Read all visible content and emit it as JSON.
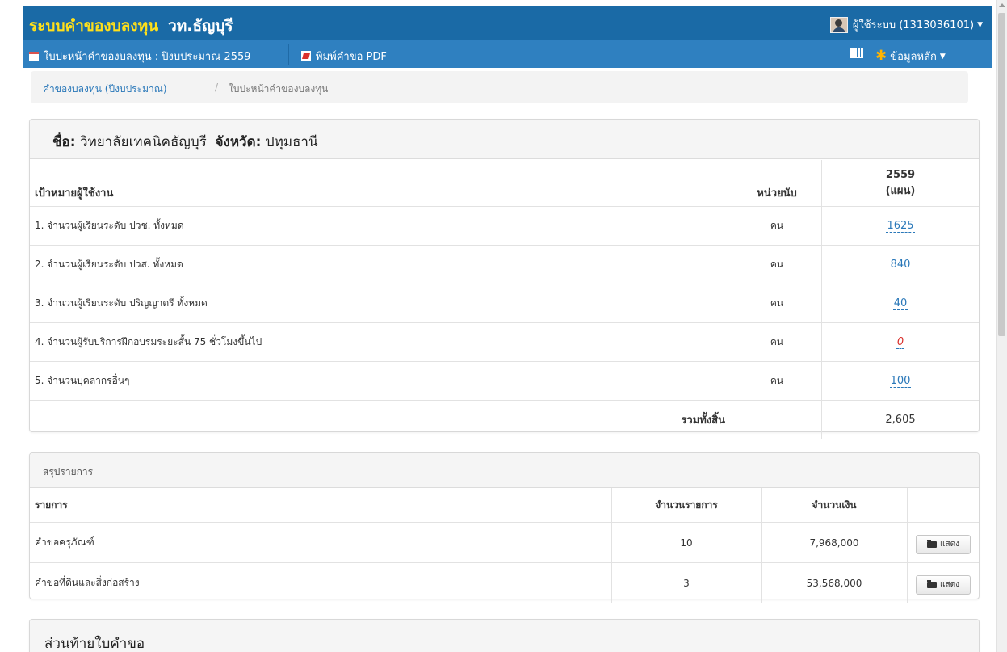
{
  "header": {
    "brand_title": "ระบบคำของบลงทุน",
    "brand_school": "วท.ธัญบุรี",
    "user_label": "ผู้ใช้ระบบ (1313036101)"
  },
  "subnav": {
    "form_label": "ใบปะหน้าคำของบลงทุน : ปีงบประมาณ 2559",
    "pdf_label": "พิมพ์คำขอ PDF",
    "main_data_label": "ข้อมูลหลัก"
  },
  "breadcrumb": {
    "link": "คำของบลงทุน (ปีงบประมาณ)",
    "separator": "/",
    "current": "ใบปะหน้าคำของบลงทุน"
  },
  "target_panel": {
    "name_key": "ชื่อ:",
    "name_value": "วิทยาลัยเทคนิคธัญบุรี",
    "province_key": "จังหวัด:",
    "province_value": "ปทุมธานี",
    "columns": {
      "target": "เป้าหมายผู้ใช้งาน",
      "unit": "หน่วยนับ",
      "year": "2559",
      "plan": "(แผน)"
    },
    "rows": [
      {
        "label": "1. จำนวนผู้เรียนระดับ ปวช. ทั้งหมด",
        "unit": "คน",
        "value": "1625"
      },
      {
        "label": "2. จำนวนผู้เรียนระดับ ปวส. ทั้งหมด",
        "unit": "คน",
        "value": "840"
      },
      {
        "label": "3. จำนวนผู้เรียนระดับ ปริญญาตรี ทั้งหมด",
        "unit": "คน",
        "value": "40"
      },
      {
        "label": "4. จำนวนผู้รับบริการฝึกอบรมระยะสั้น 75 ชั่วโมงขึ้นไป",
        "unit": "คน",
        "value": "0"
      },
      {
        "label": "5. จำนวนบุคลากรอื่นๆ",
        "unit": "คน",
        "value": "100"
      }
    ],
    "total_label": "รวมทั้งสิ้น",
    "total_value": "2,605"
  },
  "summary_panel": {
    "title": "สรุปรายการ",
    "columns": {
      "item": "รายการ",
      "count": "จำนวนรายการ",
      "amount": "จำนวนเงิน"
    },
    "rows": [
      {
        "label": "คำขอครุภัณฑ์",
        "count": "10",
        "amount": "7,968,000",
        "button": "แสดง"
      },
      {
        "label": "คำขอที่ดินและสิ่งก่อสร้าง",
        "count": "3",
        "amount": "53,568,000",
        "button": "แสดง"
      }
    ]
  },
  "footer_panel": {
    "title": "ส่วนท้ายใบคำขอ"
  },
  "colors": {
    "topbar": "#1a6aa6",
    "subbar": "#2f80c0",
    "brand_accent": "#ffe01a",
    "link": "#2a78b9",
    "zero_value": "#d9302c"
  }
}
